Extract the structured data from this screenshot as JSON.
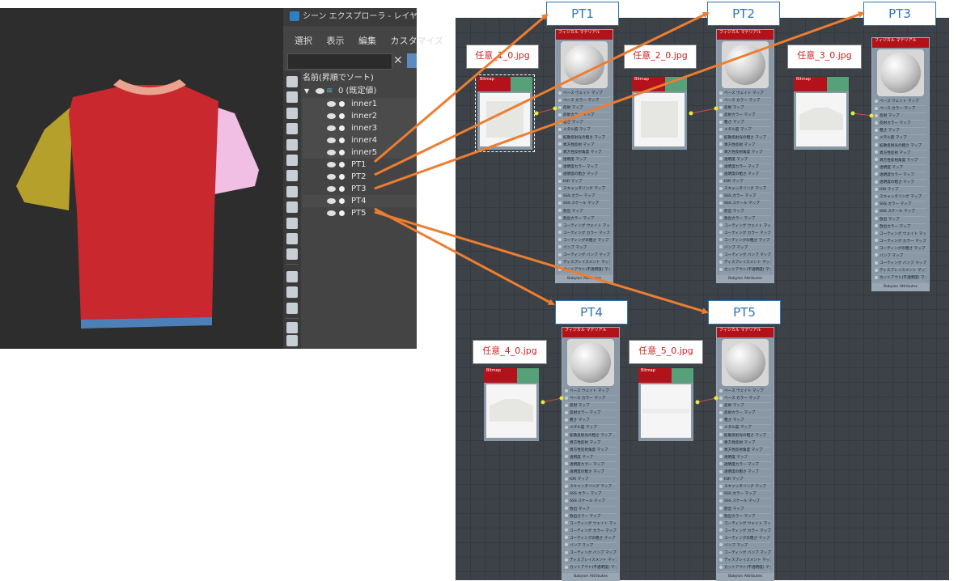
{
  "scene_explorer": {
    "title": "シーン エクスプローラ - レイヤ エクスプ",
    "menu": [
      "選択",
      "表示",
      "編集",
      "カスタマイズ"
    ],
    "clear_glyph": "✕",
    "sort_header": "名前(昇順でソート)",
    "root_layer": "0 (既定値)",
    "items": [
      "inner1",
      "inner2",
      "inner3",
      "inner4",
      "inner5",
      "PT1",
      "PT2",
      "PT3",
      "PT4",
      "PT5"
    ]
  },
  "graph": {
    "material_header": "フィジカル マテリアル",
    "material_footer": "Babylon Attributes",
    "bitmap_header": "Bitmap",
    "slots": [
      "ベース ウェイト マップ",
      "ベース カラー マップ",
      "反射 マップ",
      "反射カラー マップ",
      "粗さ マップ",
      "メタル度 マップ",
      "拡散反射光の粗さ マップ",
      "異方性反射 マップ",
      "異方性反射角度 マップ",
      "透明度 マップ",
      "透明度カラー マップ",
      "透明度の粗さ マップ",
      "IOR マップ",
      "スキャッタリング マップ",
      "SSS カラー マップ",
      "SSS スケール マップ",
      "放出 マップ",
      "放出カラー マップ",
      "コーティング ウェイト マップ",
      "コーティング カラー マップ",
      "コーティングの粗さ マップ",
      "バンプ マップ",
      "コーティング バンプ マップ",
      "ディスプレイスメント マップ",
      "カットアウト(不透明度) マップ"
    ]
  },
  "callouts": {
    "files": [
      "任意_1_0.jpg",
      "任意_2_0.jpg",
      "任意_3_0.jpg",
      "任意_4_0.jpg",
      "任意_5_0.jpg"
    ],
    "pts": [
      "PT1",
      "PT2",
      "PT3",
      "PT4",
      "PT5"
    ]
  },
  "colors": {
    "arrow": "#ed7d31",
    "callout_border": "#2e75b6",
    "material_header": "#b3121a",
    "bitmap_header": "#56a07a"
  }
}
